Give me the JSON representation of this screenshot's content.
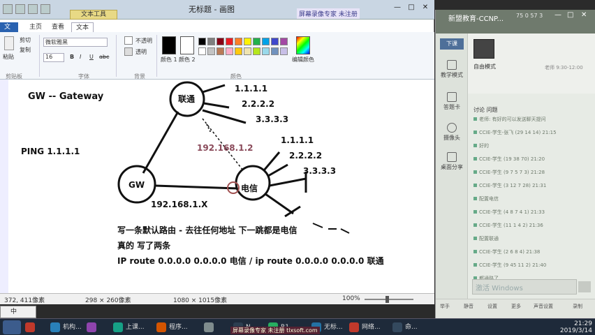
{
  "paint": {
    "window_title": "无标题 - 画图",
    "context_tab": "文本工具",
    "banner": "屏幕录像专家 未注册",
    "controls": {
      "minimize": "—",
      "maximize": "□",
      "close": "✕"
    },
    "tabs": [
      "文件",
      "主页",
      "查看",
      "文本"
    ],
    "ribbon": {
      "clipboard": {
        "paste": "粘贴",
        "cut": "剪切",
        "copy": "复制",
        "group": "剪贴板"
      },
      "font": {
        "name": "微软雅黑",
        "size": "16",
        "bold": "B",
        "italic": "I",
        "underline": "U",
        "strike": "abc",
        "group": "字体"
      },
      "background": {
        "opaque": "不透明",
        "transparent": "透明",
        "group": "背景"
      },
      "colors": {
        "color1": "颜色 1",
        "color2": "颜色 2",
        "edit": "编辑颜色",
        "group": "颜色",
        "palette": [
          "#000000",
          "#7f7f7f",
          "#880015",
          "#ed1c24",
          "#ff7f27",
          "#fff200",
          "#22b14c",
          "#00a2e8",
          "#3f48cc",
          "#a349a4",
          "#ffffff",
          "#c3c3c3",
          "#b97a57",
          "#ffaec9",
          "#ffc90e",
          "#efe4b0",
          "#b5e61d",
          "#99d9ea",
          "#7092be",
          "#c8bfe7"
        ]
      }
    },
    "canvas_text": {
      "gw_gateway": "GW -- Gateway",
      "ping": "PING 1.1.1.1",
      "unicom": "联通",
      "telecom": "电信",
      "gw": "GW",
      "unicom_ips": [
        "1.1.1.1",
        "2.2.2.2",
        "3.3.3.3"
      ],
      "telecom_ips": [
        "1.1.1.1",
        "2.2.2.2",
        "3.3.3.3"
      ],
      "ip_mid": "192.168.1.2",
      "ip_gw": "192.168.1.X",
      "line1": "写一条默认路由 - 去往任何地址 下一跳都是电信",
      "line2": "真的 写了两条",
      "line3": "IP route 0.0.0.0 0.0.0.0 电信  /  ip route 0.0.0.0 0.0.0.0 联通"
    },
    "status": {
      "cursor": "372, 411像素",
      "selection": "298 × 260像素",
      "size": "1080 × 1015像素",
      "zoom": "100%"
    }
  },
  "chat": {
    "title": "新盟教育-CCNP...",
    "stats": "75  0  57  3",
    "controls": {
      "minimize": "—",
      "maximize": "□",
      "close": "✕"
    },
    "exit": "下课",
    "rail": [
      {
        "label": "教学模式",
        "icon": "monitor-icon"
      },
      {
        "label": "答题卡",
        "icon": "edit-icon"
      },
      {
        "label": "摄像头",
        "icon": "camera-icon"
      },
      {
        "label": "桌面分享",
        "icon": "screen-share-icon"
      }
    ],
    "teacher_mode": "自由模式",
    "teacher_sub": "老师 9:30-12:00",
    "msg_tabs": "讨论  问题",
    "messages": [
      "老师: 有好的可以发送聊天提问",
      "CCIE-学生-张飞 (29 14 14) 21:15",
      "好的",
      "CCIE-学生 (19 38 70) 21:20",
      "CCIE-学生 (9 7 5 7 3) 21:28",
      "CCIE-学生 (3 12 7 28) 21:31",
      "配置电信",
      "CCIE-学生 (4 8 7 4 1) 21:33",
      "CCIE-学生 (11 1 4 2) 21:36",
      "配置联通",
      "CCIE-学生 (2 6 8 4) 21:38",
      "CCIE-学生 (9 45 11 2) 21:40",
      "都通路了"
    ],
    "input_placeholder": "激活 Windows",
    "footer": [
      "举手",
      "静音",
      "设置",
      "更多",
      "声音设置",
      "录制"
    ]
  },
  "taskbar": {
    "items": [
      {
        "label": "",
        "color": "#c0392b"
      },
      {
        "label": "机构...",
        "color": "#2980b9"
      },
      {
        "label": "",
        "color": "#8e44ad"
      },
      {
        "label": "上课...",
        "color": "#16a085"
      },
      {
        "label": "程序...",
        "color": "#d35400"
      },
      {
        "label": "",
        "color": "#7f8c8d"
      },
      {
        "label": "N",
        "color": "#2c3e50"
      },
      {
        "label": "R1",
        "color": "#27ae60"
      },
      {
        "label": "无标...",
        "color": "#2471a3"
      },
      {
        "label": "网络...",
        "color": "#c0392b"
      },
      {
        "label": "命...",
        "color": "#34495e"
      }
    ],
    "time": "21:29",
    "date": "2019/3/14",
    "ime": "中",
    "recorder": "屏幕录像专家 未注册 tlxsoft.com"
  }
}
